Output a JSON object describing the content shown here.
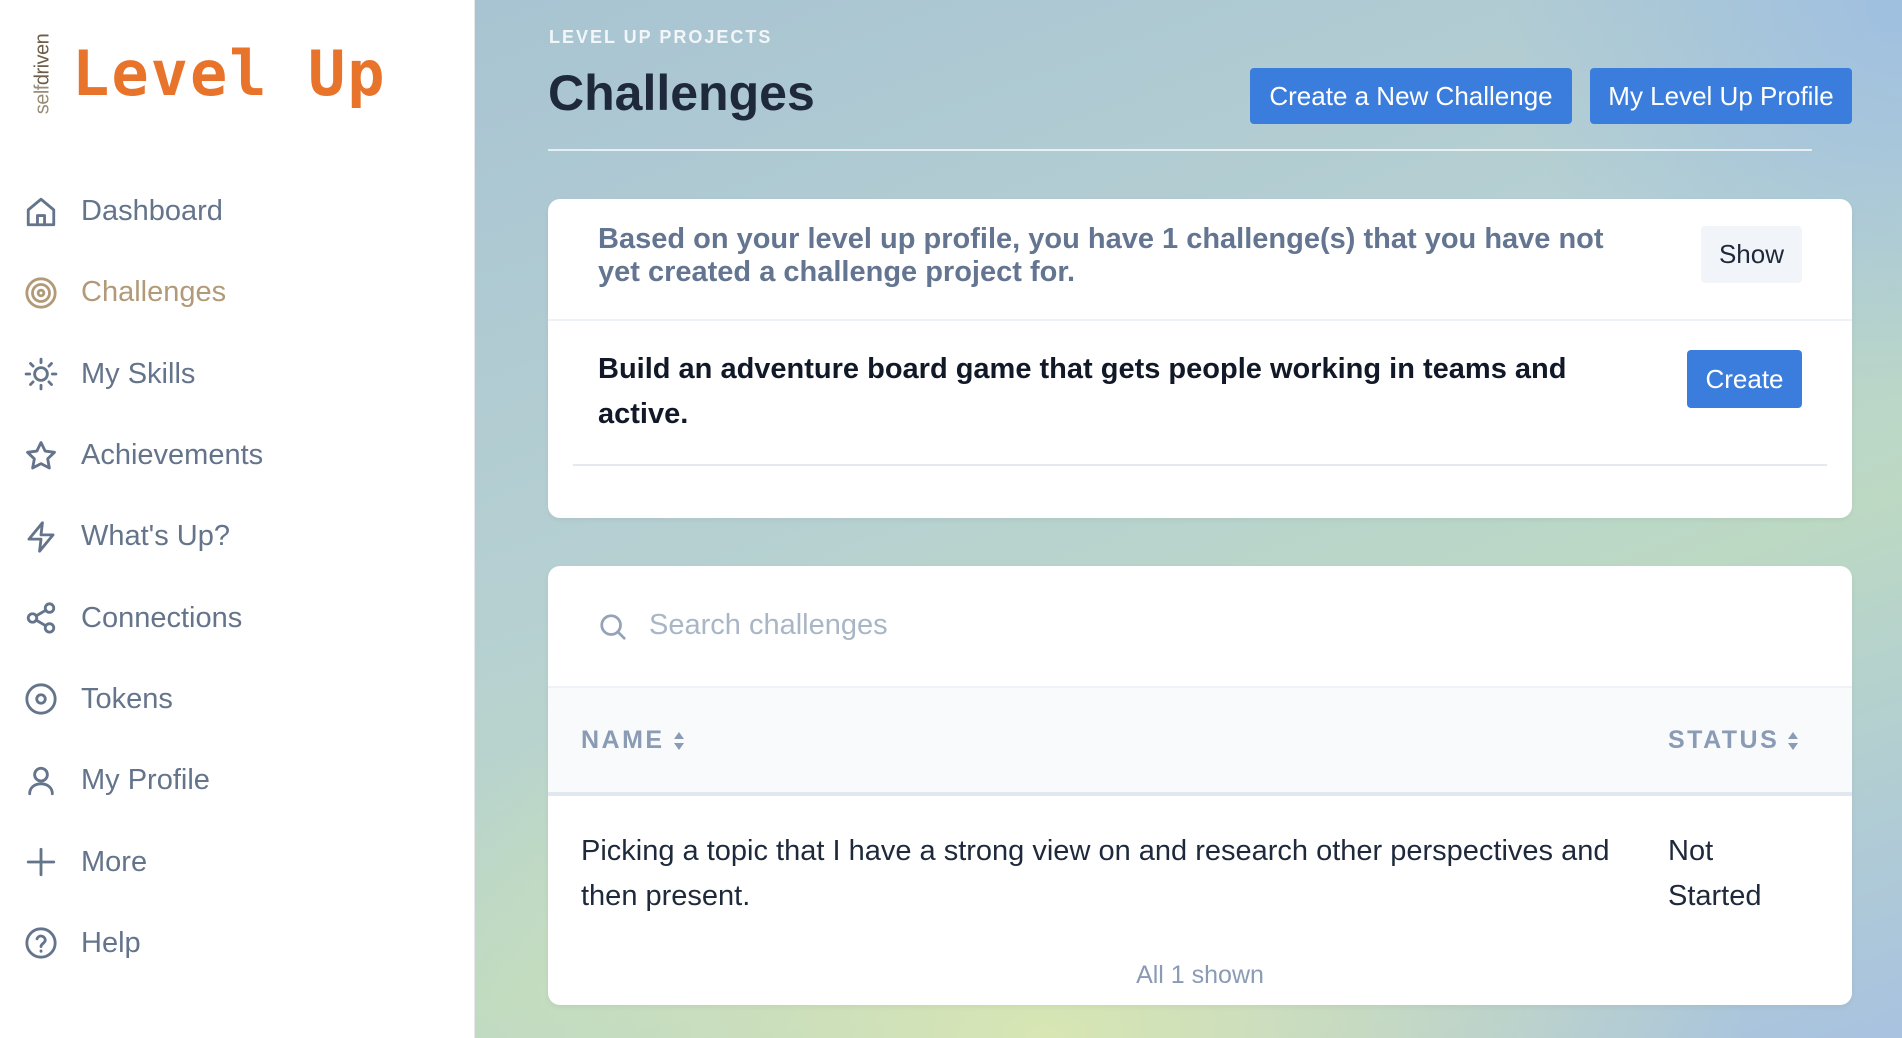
{
  "brand": {
    "side_text_light": "self",
    "side_text_dark": "driven",
    "name": "Level Up",
    "accent_color": "#e8732a"
  },
  "sidebar": {
    "items": [
      {
        "label": "Dashboard",
        "icon": "home-icon",
        "active": false
      },
      {
        "label": "Challenges",
        "icon": "target-icon",
        "active": true
      },
      {
        "label": "My Skills",
        "icon": "sun-icon",
        "active": false
      },
      {
        "label": "Achievements",
        "icon": "star-icon",
        "active": false
      },
      {
        "label": "What's Up?",
        "icon": "lightning-icon",
        "active": false
      },
      {
        "label": "Connections",
        "icon": "share-icon",
        "active": false
      },
      {
        "label": "Tokens",
        "icon": "disc-icon",
        "active": false
      },
      {
        "label": "My Profile",
        "icon": "user-icon",
        "active": false
      },
      {
        "label": "More",
        "icon": "plus-icon",
        "active": false
      },
      {
        "label": "Help",
        "icon": "help-circle-icon",
        "active": false
      }
    ]
  },
  "header": {
    "eyebrow": "LEVEL UP PROJECTS",
    "title": "Challenges",
    "create_button": "Create a New Challenge",
    "profile_button": "My Level Up Profile"
  },
  "notice": {
    "text": "Based on your level up profile, you have 1 challenge(s) that you have not yet created a challenge project for.",
    "show_button": "Show",
    "challenge": "Build an adventure board game that gets people working in teams and active.",
    "create_button": "Create"
  },
  "table": {
    "search_placeholder": "Search challenges",
    "columns": {
      "name": "NAME",
      "status": "STATUS"
    },
    "rows": [
      {
        "name": "Picking a topic that I have a strong view on and research other perspectives and then present.",
        "status": "Not Started"
      }
    ],
    "footer": "All 1 shown"
  },
  "colors": {
    "primary_button": "#3b7ddd",
    "active_nav": "#b29a78"
  }
}
